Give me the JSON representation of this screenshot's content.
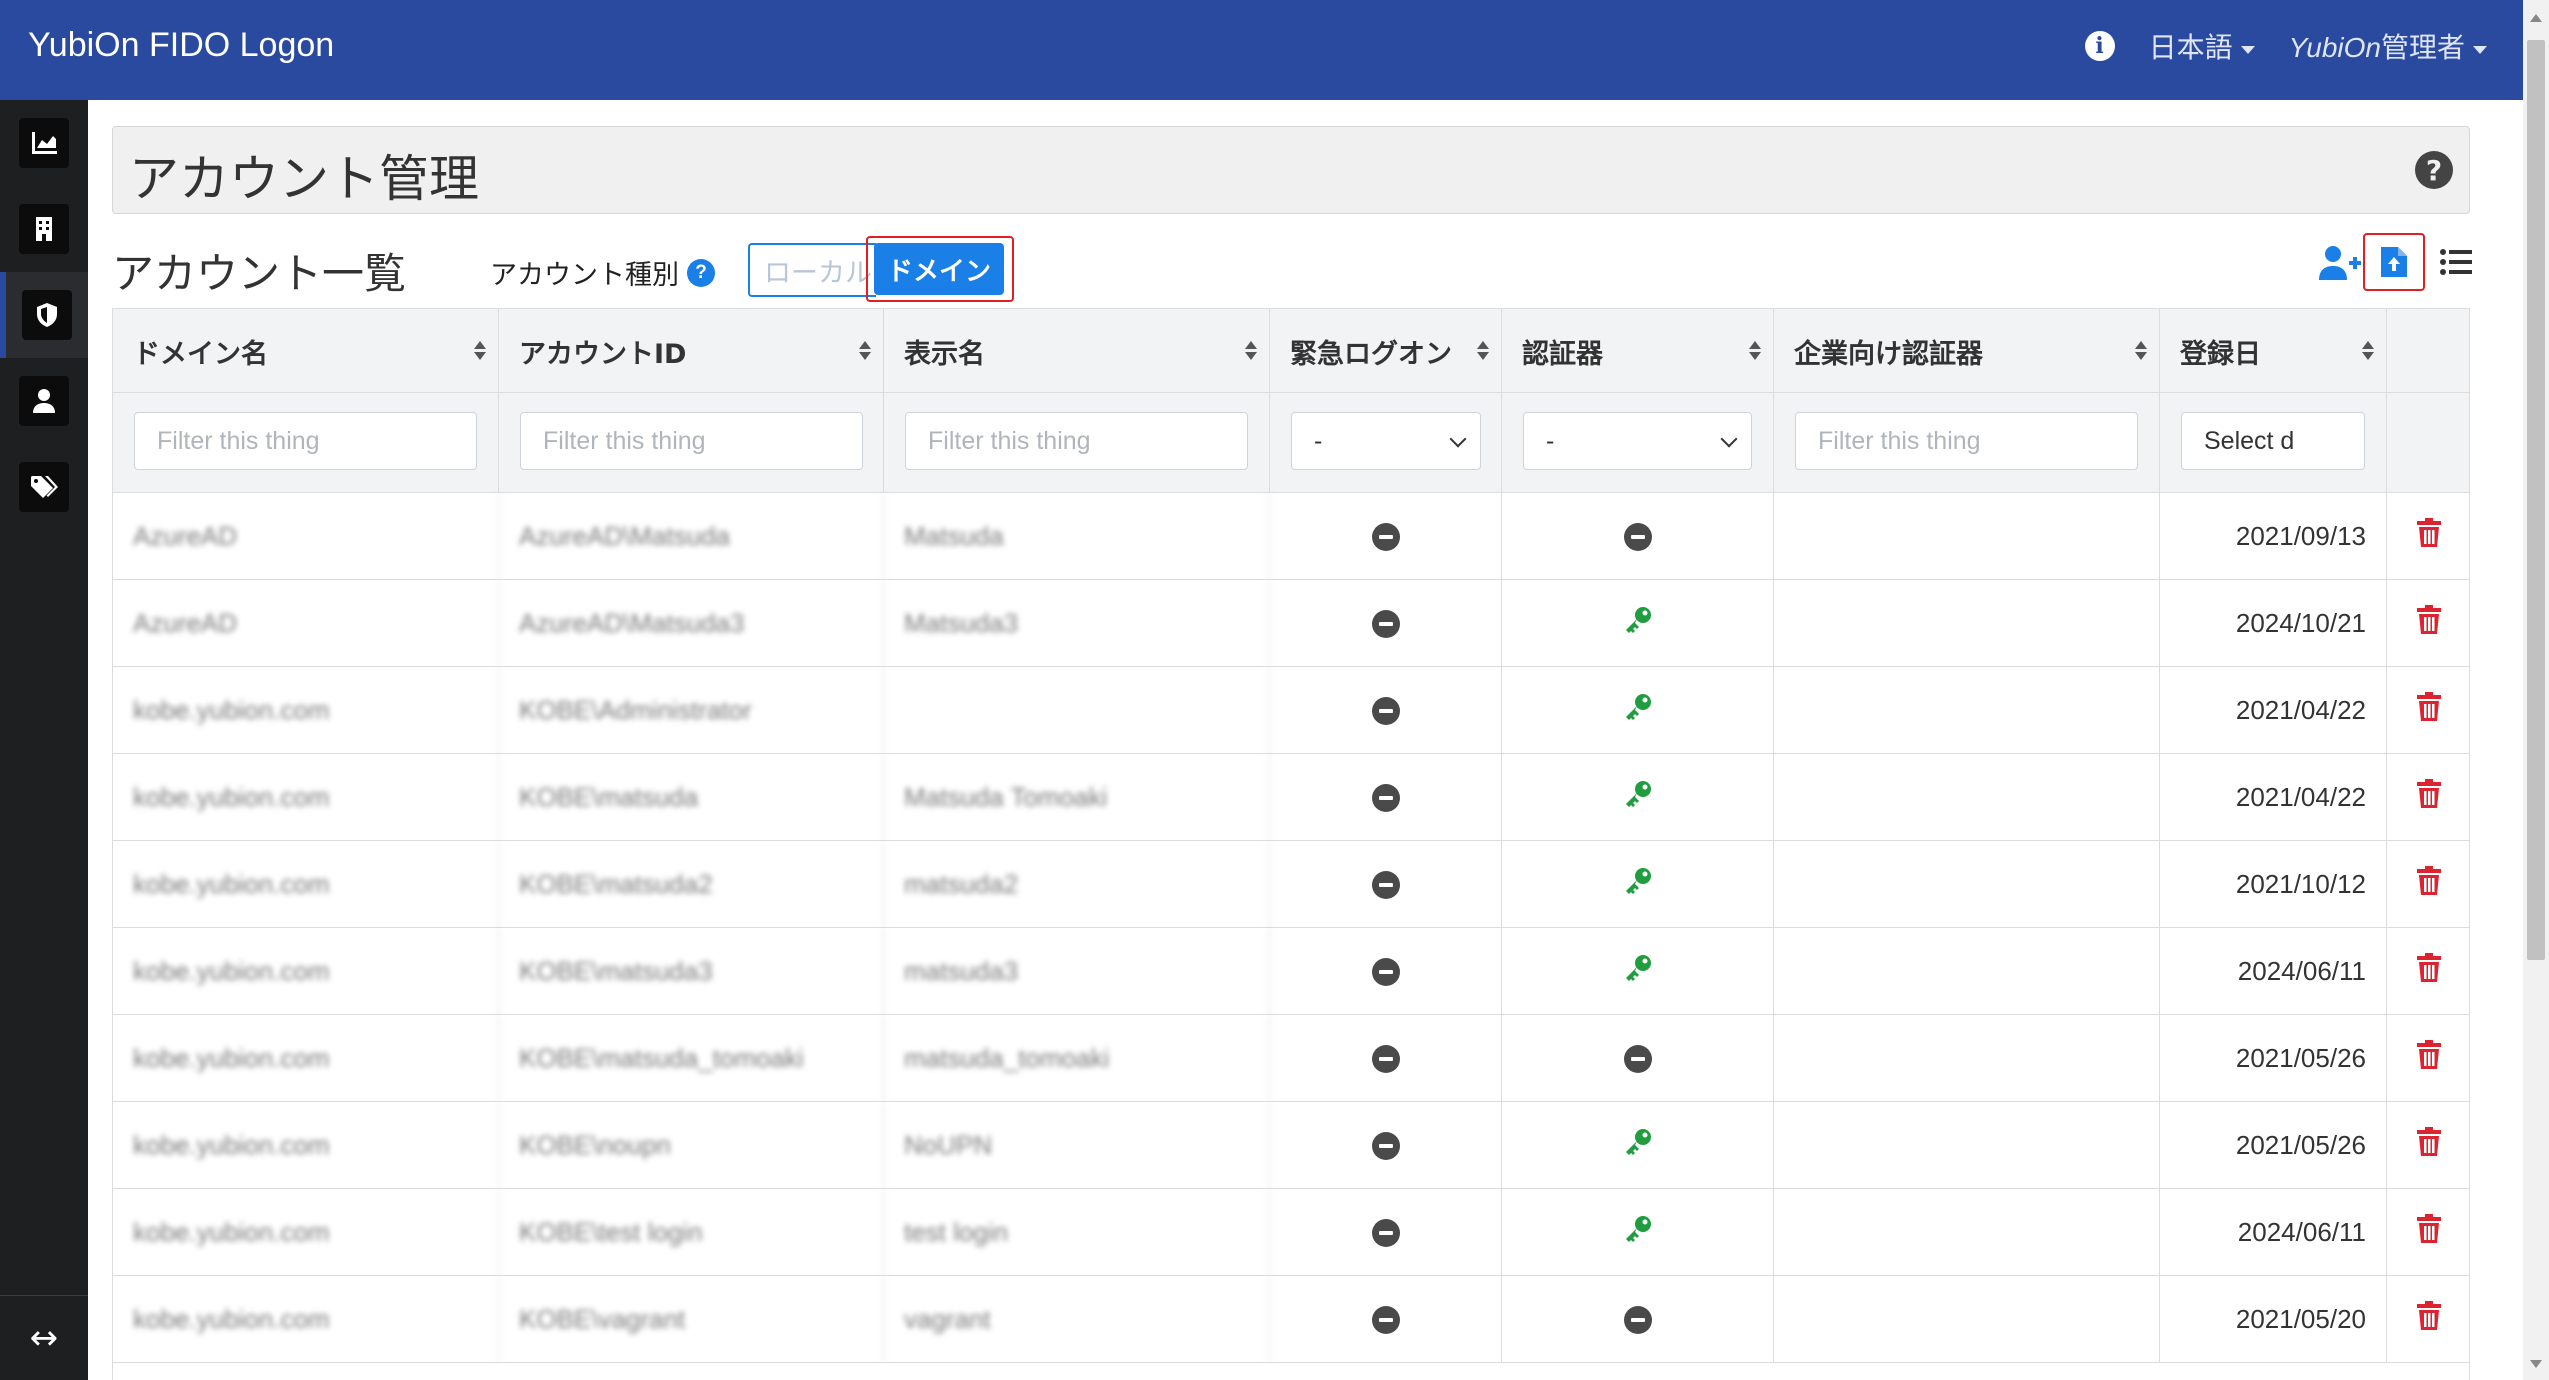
{
  "app": {
    "brand": "YubiOn FIDO Logon"
  },
  "topnav": {
    "language": "日本語",
    "admin_prefix": "YubiOn",
    "admin_suffix": "管理者"
  },
  "sidebar": {
    "items": [
      {
        "name": "dashboard",
        "icon": "area-chart-icon"
      },
      {
        "name": "organization",
        "icon": "building-icon"
      },
      {
        "name": "security",
        "icon": "shield-icon",
        "active": true
      },
      {
        "name": "users",
        "icon": "user-icon"
      },
      {
        "name": "tags",
        "icon": "tags-icon"
      }
    ],
    "bottom_icon": "arrows-horizontal-icon"
  },
  "page": {
    "title": "アカウント管理",
    "list_title": "アカウント一覧",
    "account_type_label": "アカウント種別",
    "segment": {
      "local": "ローカル",
      "domain": "ドメイン",
      "selected": "domain"
    }
  },
  "table": {
    "headers": [
      "ドメイン名",
      "アカウントID",
      "表示名",
      "緊急ログオン",
      "認証器",
      "企業向け認証器",
      "登録日"
    ],
    "filters": {
      "text_placeholder": "Filter this thing",
      "select_value": "-",
      "date_placeholder": "Select d"
    },
    "rows": [
      {
        "domain": "AzureAD",
        "account_id": "AzureAD\\Matsuda",
        "display_name": "Matsuda",
        "emergency": "minus",
        "authenticator": "minus",
        "date": "2021/09/13"
      },
      {
        "domain": "AzureAD",
        "account_id": "AzureAD\\Matsuda3",
        "display_name": "Matsuda3",
        "emergency": "minus",
        "authenticator": "key",
        "date": "2024/10/21"
      },
      {
        "domain": "kobe.yubion.com",
        "account_id": "KOBE\\Administrator",
        "display_name": "",
        "emergency": "minus",
        "authenticator": "key",
        "date": "2021/04/22"
      },
      {
        "domain": "kobe.yubion.com",
        "account_id": "KOBE\\matsuda",
        "display_name": "Matsuda Tomoaki",
        "emergency": "minus",
        "authenticator": "key",
        "date": "2021/04/22"
      },
      {
        "domain": "kobe.yubion.com",
        "account_id": "KOBE\\matsuda2",
        "display_name": "matsuda2",
        "emergency": "minus",
        "authenticator": "key",
        "date": "2021/10/12"
      },
      {
        "domain": "kobe.yubion.com",
        "account_id": "KOBE\\matsuda3",
        "display_name": "matsuda3",
        "emergency": "minus",
        "authenticator": "key",
        "date": "2024/06/11"
      },
      {
        "domain": "kobe.yubion.com",
        "account_id": "KOBE\\matsuda_tomoaki",
        "display_name": "matsuda_tomoaki",
        "emergency": "minus",
        "authenticator": "minus",
        "date": "2021/05/26"
      },
      {
        "domain": "kobe.yubion.com",
        "account_id": "KOBE\\noupn",
        "display_name": "NoUPN",
        "emergency": "minus",
        "authenticator": "key",
        "date": "2021/05/26"
      },
      {
        "domain": "kobe.yubion.com",
        "account_id": "KOBE\\test login",
        "display_name": "test login",
        "emergency": "minus",
        "authenticator": "key",
        "date": "2024/06/11"
      },
      {
        "domain": "kobe.yubion.com",
        "account_id": "KOBE\\vagrant",
        "display_name": "vagrant",
        "emergency": "minus",
        "authenticator": "minus",
        "date": "2021/05/20"
      }
    ]
  },
  "colors": {
    "topbar": "#2a4aa0",
    "primary": "#1a7fe6",
    "key": "#1f9d3f",
    "delete": "#dc2330",
    "highlight": "#e02020"
  }
}
